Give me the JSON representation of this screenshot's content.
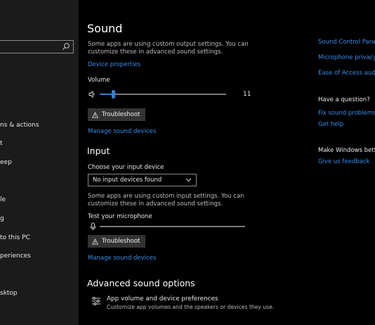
{
  "sidebar": {
    "items": [
      {
        "label": "ns & actions"
      },
      {
        "label": "t"
      },
      {
        "label": "eep"
      },
      {
        "label": "le"
      },
      {
        "label": "g"
      },
      {
        "label": "to this PC"
      },
      {
        "label": "periences"
      },
      {
        "label": "sktop"
      }
    ]
  },
  "sound": {
    "title": "Sound",
    "output_desc": "Some apps are using custom output settings. You can customize these in advanced sound settings.",
    "device_properties": "Device properties",
    "volume_label": "Volume",
    "volume_value": "11",
    "volume_level_percent": 11,
    "troubleshoot": "Troubleshoot",
    "manage_devices": "Manage sound devices"
  },
  "input": {
    "title": "Input",
    "choose_label": "Choose your input device",
    "selected_device": "No input devices found",
    "desc": "Some apps are using custom input settings. You can customize these in advanced sound settings.",
    "test_label": "Test your microphone",
    "troubleshoot": "Troubleshoot",
    "manage_devices": "Manage sound devices"
  },
  "advanced": {
    "title": "Advanced sound options",
    "app_volume_title": "App volume and device preferences",
    "app_volume_desc": "Customize app volumes and the speakers or devices they use."
  },
  "related": {
    "links": [
      {
        "label": "Sound Control Panel"
      },
      {
        "label": "Microphone privacy se"
      },
      {
        "label": "Ease of Access audio s"
      }
    ],
    "question_title": "Have a question?",
    "help_links": [
      {
        "label": "Fix sound problems"
      },
      {
        "label": "Get help"
      }
    ],
    "better_title": "Make Windows better",
    "feedback_link": "Give us feedback"
  },
  "colors": {
    "accent": "#2f7fd8",
    "link": "#3a8ee6",
    "sidebar_bg": "#1b1b1b",
    "page_bg": "#000000"
  }
}
